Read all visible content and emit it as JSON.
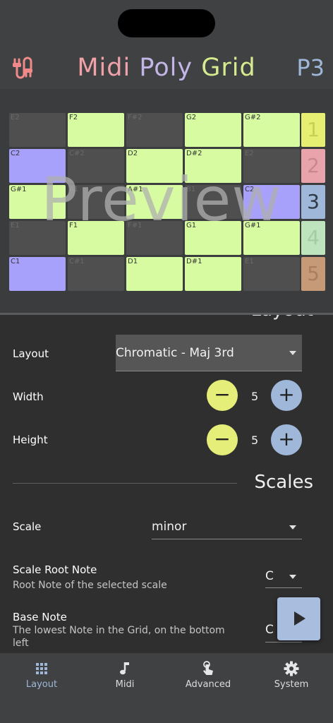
{
  "header": {
    "title_parts": [
      "Midi",
      "Poly",
      "Grid"
    ],
    "preset": "P3",
    "app_icon": "midi-cable-icon"
  },
  "grid": {
    "rows": [
      [
        {
          "note": "E2",
          "state": "off"
        },
        {
          "note": "F2",
          "state": "scale"
        },
        {
          "note": "F#2",
          "state": "off"
        },
        {
          "note": "G2",
          "state": "scale"
        },
        {
          "note": "G#2",
          "state": "scale"
        }
      ],
      [
        {
          "note": "C2",
          "state": "root"
        },
        {
          "note": "C#2",
          "state": "off"
        },
        {
          "note": "D2",
          "state": "scale"
        },
        {
          "note": "D#2",
          "state": "scale"
        },
        {
          "note": "E2",
          "state": "off"
        }
      ],
      [
        {
          "note": "G#1",
          "state": "scale"
        },
        {
          "note": "A1",
          "state": "off"
        },
        {
          "note": "A#1",
          "state": "scale"
        },
        {
          "note": "B1",
          "state": "off"
        },
        {
          "note": "C2",
          "state": "root"
        }
      ],
      [
        {
          "note": "E1",
          "state": "off"
        },
        {
          "note": "F1",
          "state": "scale"
        },
        {
          "note": "F#1",
          "state": "off"
        },
        {
          "note": "G1",
          "state": "scale"
        },
        {
          "note": "G#1",
          "state": "scale"
        }
      ],
      [
        {
          "note": "C1",
          "state": "root"
        },
        {
          "note": "C#1",
          "state": "off"
        },
        {
          "note": "D1",
          "state": "scale"
        },
        {
          "note": "D#1",
          "state": "scale"
        },
        {
          "note": "E1",
          "state": "off"
        }
      ]
    ],
    "banks": [
      {
        "label": "1",
        "color": "#e7ef72",
        "text": "#c9d050"
      },
      {
        "label": "2",
        "color": "#e8a3ab",
        "text": "#c98890"
      },
      {
        "label": "3",
        "color": "#9fb7d9",
        "text": "#2f3a47"
      },
      {
        "label": "4",
        "color": "#bde4bd",
        "text": "#a4cba4"
      },
      {
        "label": "5",
        "color": "#c79a77",
        "text": "#a9805f"
      }
    ],
    "colors": {
      "scale": "#d6fba0",
      "root": "#a7a1fb",
      "off": "#4f4f4f"
    },
    "watermark": "Preview"
  },
  "settings": {
    "layout_section": "Layout",
    "layout_label": "Layout",
    "layout_value": "Chromatic - Maj 3rd",
    "width_label": "Width",
    "width_value": "5",
    "height_label": "Height",
    "height_value": "5",
    "minus": "−",
    "plus": "+",
    "scales_section": "Scales",
    "scale_label": "Scale",
    "scale_value": "minor",
    "root_label": "Scale Root Note",
    "root_sub": "Root Note of the selected scale",
    "root_value": "C",
    "base_label": "Base Note",
    "base_sub_1": "The lowest Note in the Grid, on the bottom",
    "base_sub_2": "left",
    "base_value": "C"
  },
  "nav": [
    {
      "label": "Layout",
      "icon": "grid-icon",
      "active": true
    },
    {
      "label": "Midi",
      "icon": "music-note-icon",
      "active": false
    },
    {
      "label": "Advanced",
      "icon": "touch-icon",
      "active": false
    },
    {
      "label": "System",
      "icon": "gear-icon",
      "active": false
    }
  ],
  "play_icon": "play-icon"
}
